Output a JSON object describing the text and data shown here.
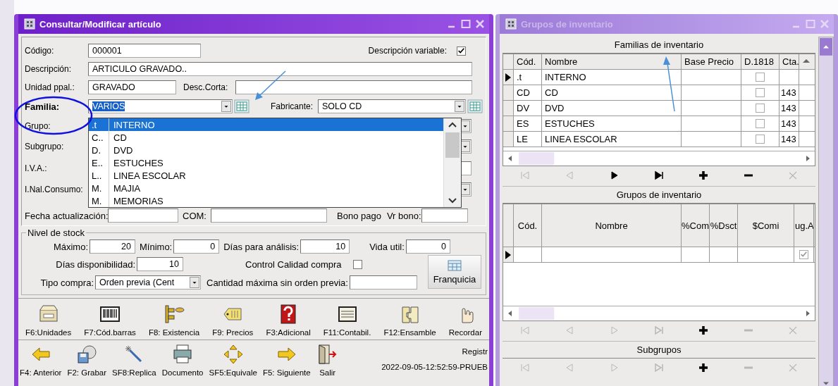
{
  "main_window": {
    "title": "Consultar/Modificar artículo",
    "codigo": {
      "label": "Código:",
      "value": "000001"
    },
    "descripcion_variable": {
      "label": "Descripción variable:",
      "checked": true
    },
    "descripcion": {
      "label": "Descripción:",
      "value": "ARTICULO GRAVADO.."
    },
    "unidad_ppal": {
      "label": "Unidad ppal.:",
      "value": "GRAVADO"
    },
    "desc_corta": {
      "label": "Desc.Corta:"
    },
    "familia": {
      "label": "Familia:",
      "value": "VARIOS"
    },
    "fabricante": {
      "label": "Fabricante:",
      "value": "SOLO CD"
    },
    "covered_rows": [
      {
        "label": "Grupo:",
        "kind": "combo"
      },
      {
        "label": "Subgrupo:",
        "kind": "combo"
      },
      {
        "label": "I.V.A.:",
        "kind": "field"
      },
      {
        "label": "I.Nal.Consumo:",
        "kind": "combo"
      }
    ],
    "familia_dropdown": [
      {
        "code": ".t",
        "name": "INTERNO",
        "selected": true
      },
      {
        "code": "C..",
        "name": "CD",
        "selected": false
      },
      {
        "code": "D.",
        "name": "DVD",
        "selected": false
      },
      {
        "code": "E..",
        "name": "ESTUCHES",
        "selected": false
      },
      {
        "code": "L..",
        "name": "LINEA ESCOLAR",
        "selected": false
      },
      {
        "code": "M.",
        "name": "MAJIA",
        "selected": false
      },
      {
        "code": "M.",
        "name": "MEMORIAS",
        "selected": false
      }
    ],
    "fecha_row": [
      {
        "label": "Fecha actualización:"
      },
      {
        "label": "COM:"
      },
      {
        "label": "Bono pago"
      },
      {
        "label": "Vr bono:"
      }
    ],
    "stock": {
      "legend": "Nivel de stock",
      "limits": [
        {
          "label": "Máximo:",
          "value": "20"
        },
        {
          "label": "Mínimo:",
          "value": "0"
        },
        {
          "label": "Días para análisis:",
          "value": "10"
        },
        {
          "label": "Vida util:",
          "value": "0"
        }
      ],
      "disponibilidad": {
        "label": "Días disponibilidad:",
        "value": "10"
      },
      "control_calidad": {
        "label": "Control Calidad compra",
        "checked": false
      },
      "tipo_compra": {
        "label": "Tipo compra:",
        "value": "Orden previa (Cent"
      },
      "cantidad_maxima": {
        "label": "Cantidad máxima sin orden previa:"
      },
      "franquicia_button": "Franquicia"
    },
    "toolbar_1": [
      "F6:Unidades",
      "F7:Cód.barras",
      "F8: Existencia",
      "F9: Precios",
      "F3:Adicional",
      "F11:Contabil.",
      "F12:Ensamble",
      "Recordar"
    ],
    "toolbar_2": [
      "F4: Anterior",
      "F2: Grabar",
      "SF8:Replica",
      "Documento",
      "SF5:Equivale",
      "F5: Siguiente",
      "Salir"
    ],
    "record": {
      "label": "Registr",
      "value": "2022-09-05-12:52:59-PRUEB"
    }
  },
  "inventory_window": {
    "title": "Grupos de inventario",
    "familias": {
      "title": "Familias de inventario",
      "columns": [
        "Cód.",
        "Nombre",
        "Base Precio",
        "D.1818",
        "Cta."
      ],
      "rows": [
        {
          "cod": ".t",
          "nombre": "INTERNO",
          "d1818": false,
          "selected": true
        },
        {
          "cod": "CD",
          "nombre": "CD",
          "d1818": false,
          "cta": "143",
          "selected": false
        },
        {
          "cod": "DV",
          "nombre": "DVD",
          "d1818": false,
          "cta": "143",
          "selected": false
        },
        {
          "cod": "ES",
          "nombre": "ESTUCHES",
          "d1818": false,
          "cta": "143",
          "selected": false
        },
        {
          "cod": "LE",
          "nombre": "LINEA ESCOLAR",
          "d1818": false,
          "cta": "143",
          "selected": false
        }
      ],
      "nav": [
        {
          "kind": "first",
          "disabled": true
        },
        {
          "kind": "prior",
          "disabled": true
        },
        {
          "kind": "next",
          "disabled": false
        },
        {
          "kind": "last",
          "disabled": false
        },
        {
          "kind": "insert",
          "disabled": false
        },
        {
          "kind": "delete",
          "disabled": false
        },
        {
          "kind": "cancel",
          "disabled": true
        }
      ]
    },
    "grupos": {
      "title": "Grupos de inventario",
      "columns": [
        "Cód.",
        "Nombre",
        "%Com",
        "%Dsct",
        "$Comi",
        "ug.A"
      ],
      "rows": [
        {
          "flag": true,
          "selected": true
        }
      ],
      "nav": [
        {
          "kind": "first",
          "disabled": true
        },
        {
          "kind": "prior",
          "disabled": true
        },
        {
          "kind": "next",
          "disabled": true
        },
        {
          "kind": "last",
          "disabled": true
        },
        {
          "kind": "insert",
          "disabled": false
        },
        {
          "kind": "delete",
          "disabled": true
        },
        {
          "kind": "cancel",
          "disabled": true
        }
      ]
    },
    "subgrupos": {
      "title": "Subgrupos",
      "nav": [
        {
          "kind": "first",
          "disabled": true
        },
        {
          "kind": "prior",
          "disabled": true
        },
        {
          "kind": "next",
          "disabled": true
        },
        {
          "kind": "last",
          "disabled": true
        },
        {
          "kind": "insert",
          "disabled": false
        },
        {
          "kind": "delete",
          "disabled": true
        },
        {
          "kind": "cancel",
          "disabled": true
        }
      ]
    }
  }
}
